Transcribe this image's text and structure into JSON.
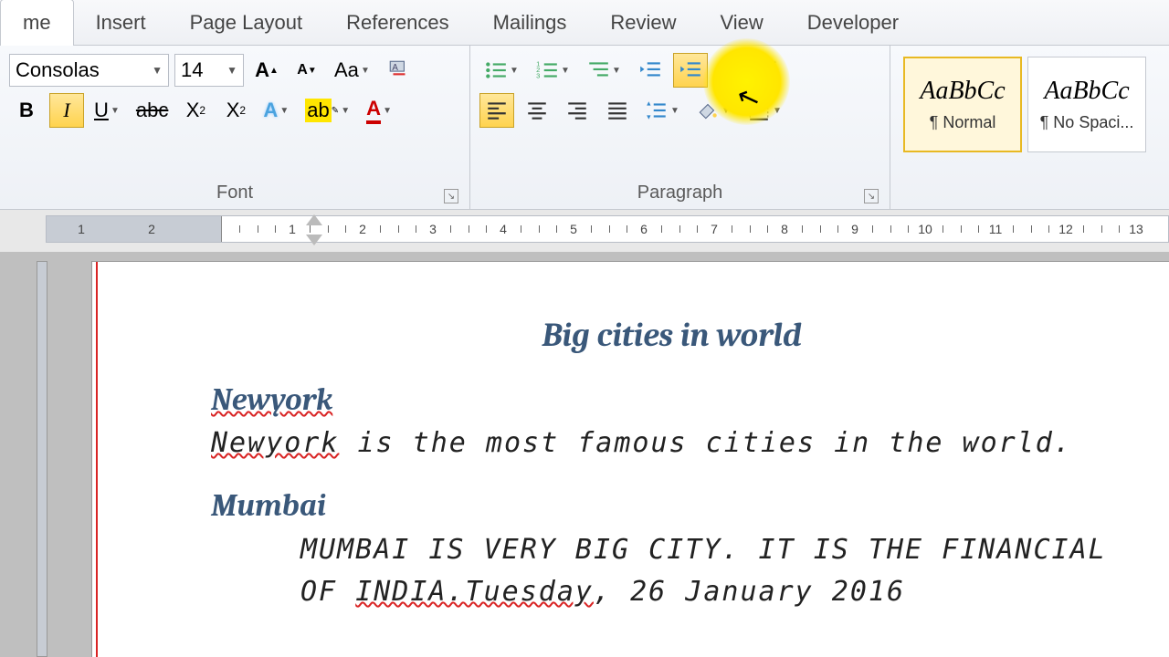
{
  "tabs": {
    "home": "me",
    "insert": "Insert",
    "pagelayout": "Page Layout",
    "references": "References",
    "mailings": "Mailings",
    "review": "Review",
    "view": "View",
    "developer": "Developer"
  },
  "font": {
    "name": "Consolas",
    "size": "14",
    "group_label": "Font"
  },
  "paragraph": {
    "group_label": "Paragraph"
  },
  "styles": {
    "s0_prev": "AaBbCc",
    "s0_name": "¶ Normal",
    "s1_prev": "AaBbCc",
    "s1_name": "¶ No Spaci..."
  },
  "ruler": {
    "nums_left": [
      "2",
      "1"
    ],
    "nums": [
      "1",
      "2",
      "3",
      "4",
      "5",
      "6",
      "7",
      "8",
      "9",
      "10",
      "11",
      "12",
      "13"
    ]
  },
  "doc": {
    "title": "Big cities in world",
    "h1": "Newyork",
    "p1a": "Newyork",
    "p1b": " is the most famous cities in the world.",
    "h2": "Mumbai",
    "p2a": "MUMBAI IS VERY BIG CITY. IT IS THE FINANCIAL OF ",
    "p2b": "INDIA.Tuesday",
    "p2c": ", 26 January 2016"
  }
}
